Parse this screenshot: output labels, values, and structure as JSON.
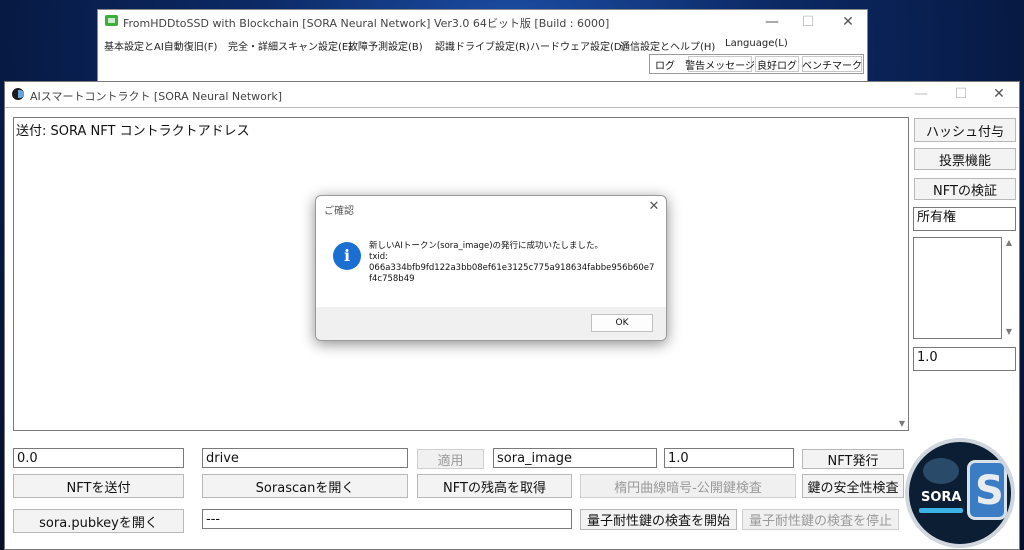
{
  "back_window": {
    "title": "FromHDDtoSSD with Blockchain [SORA Neural Network] Ver3.0 64ビット版 [Build : 6000]",
    "menu": [
      "基本設定とAI自動復旧(F)",
      "完全・詳細スキャン設定(E)",
      "故障予測設定(B)",
      "認識ドライブ設定(R)",
      "ハードウェア設定(D)",
      "通信設定とヘルプ(H)",
      "Language(L)"
    ],
    "tabs": [
      "ログ",
      "警告メッセージ",
      "良好ログ",
      "ベンチマーク"
    ]
  },
  "main_window": {
    "title": "AIスマートコントラクト [SORA Neural Network]",
    "textarea_text": "送付: SORA NFT コントラクトアドレス",
    "right_buttons": [
      "ハッシュ付与",
      "投票機能",
      "NFTの検証"
    ],
    "ownership_label": "所有権",
    "right_value": "1.0",
    "row1": {
      "amount": "0.0",
      "drive": "drive",
      "apply_label": "適用",
      "token_name": "sora_image",
      "token_amount": "1.0",
      "issue_label": "NFT発行"
    },
    "row2": [
      "NFTを送付",
      "Sorascanを開く",
      "NFTの残高を取得",
      "楕円曲線暗号-公開鍵検査",
      "鍵の安全性検査"
    ],
    "row3": {
      "open_pubkey": "sora.pubkeyを開く",
      "status_text": "---",
      "start_quantum": "量子耐性鍵の検査を開始",
      "stop_quantum": "量子耐性鍵の検査を停止"
    },
    "logo_text": "SORA"
  },
  "dialog": {
    "title": "ご確認",
    "message_line1": "新しいAIトークン(sora_image)の発行に成功いたしました。",
    "message_line2": "txid:",
    "txid_line1": "066a334bfb9fd122a3bb08ef61e3125c775a918634fabbe956b60e7",
    "txid_line2": "f4c758b49",
    "ok_label": "OK",
    "info_glyph": "i"
  },
  "colors": {
    "accent_blue": "#1a6fd1",
    "logo_dark": "#0b1e33",
    "app_icon_green": "#3cae3c"
  }
}
